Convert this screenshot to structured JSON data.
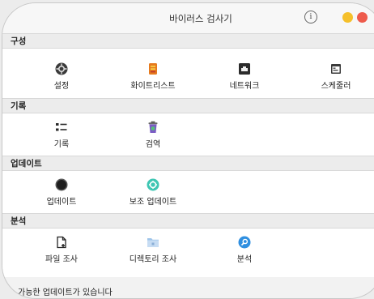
{
  "window": {
    "title": "바이러스 검사기"
  },
  "sections": [
    {
      "header": "구성",
      "items": [
        {
          "label": "설정",
          "icon": "settings-icon"
        },
        {
          "label": "화이트리스트",
          "icon": "whitelist-icon"
        },
        {
          "label": "네트워크",
          "icon": "network-icon"
        },
        {
          "label": "스케줄러",
          "icon": "scheduler-icon"
        }
      ]
    },
    {
      "header": "기록",
      "items": [
        {
          "label": "기록",
          "icon": "history-icon"
        },
        {
          "label": "검역",
          "icon": "quarantine-icon"
        }
      ]
    },
    {
      "header": "업데이트",
      "items": [
        {
          "label": "업데이트",
          "icon": "update-icon"
        },
        {
          "label": "보조 업데이트",
          "icon": "assist-update-icon"
        }
      ]
    },
    {
      "header": "분석",
      "items": [
        {
          "label": "파일 조사",
          "icon": "file-scan-icon"
        },
        {
          "label": "디렉토리 조사",
          "icon": "folder-scan-icon"
        },
        {
          "label": "분석",
          "icon": "search-icon"
        }
      ]
    }
  ],
  "status": "가능한 업데이트가 있습니다",
  "colors": {
    "traffic_yellow": "#f5c02b",
    "traffic_red": "#ee5b4c",
    "accent_blue": "#2f8fe0"
  }
}
